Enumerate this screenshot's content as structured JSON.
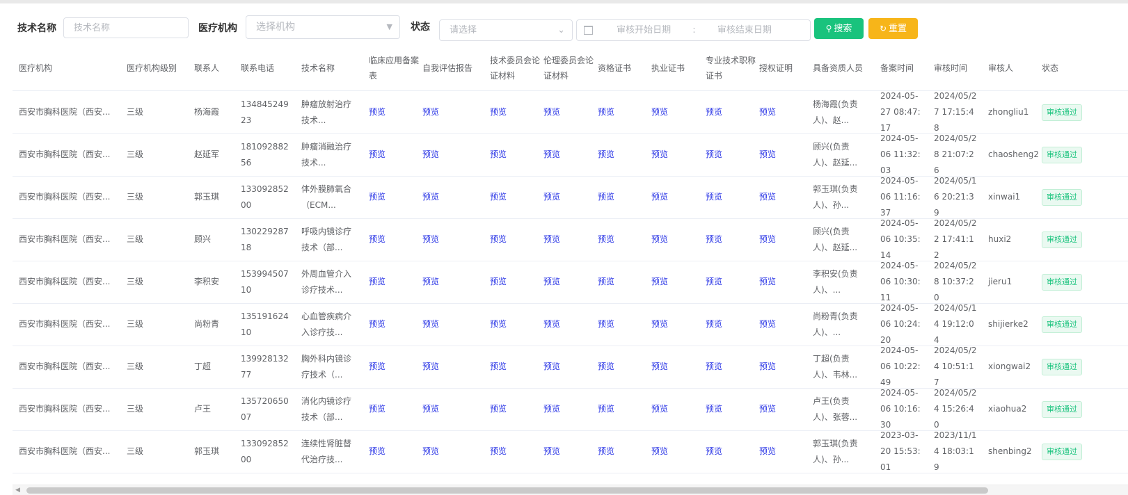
{
  "filters": {
    "tech_label": "技术名称",
    "tech_placeholder": "技术名称",
    "org_label": "医疗机构",
    "org_placeholder": "选择机构",
    "status_label": "状态",
    "status_placeholder": "请选择",
    "date_start_placeholder": "审核开始日期",
    "date_sep": ":",
    "date_end_placeholder": "审核结束日期",
    "search_button": "搜索",
    "reset_button": "重置"
  },
  "columns": [
    "医疗机构",
    "医疗机构级别",
    "联系人",
    "联系电话",
    "技术名称",
    "临床应用备案表",
    "自我评估报告",
    "技术委员会论证材料",
    "伦理委员会论证材料",
    "资格证书",
    "执业证书",
    "专业技术职称证书",
    "授权证明",
    "具备资质人员",
    "备案时间",
    "审核时间",
    "审核人",
    "状态"
  ],
  "preview_label": "预览",
  "rows": [
    {
      "org": "西安市胸科医院（西安...",
      "level": "三级",
      "contact": "杨海霞",
      "phone": "13484524923",
      "tech": "肿瘤放射治疗技术...",
      "staff": "杨海霞(负责人)、赵...",
      "filed": "2024-05-27 08:47:17",
      "audited": "2024/05/27 17:15:48",
      "auditor": "zhongliu1",
      "status": "审核通过"
    },
    {
      "org": "西安市胸科医院（西安...",
      "level": "三级",
      "contact": "赵延军",
      "phone": "18109288256",
      "tech": "肿瘤消融治疗技术...",
      "staff": "顾兴(负责人)、赵延...",
      "filed": "2024-05-06 11:32:03",
      "audited": "2024/05/28 21:07:26",
      "auditor": "chaosheng2",
      "status": "审核通过"
    },
    {
      "org": "西安市胸科医院（西安...",
      "level": "三级",
      "contact": "郭玉琪",
      "phone": "13309285200",
      "tech": "体外膜肺氧合（ECM...",
      "staff": "郭玉琪(负责人)、孙...",
      "filed": "2024-05-06 11:16:37",
      "audited": "2024/05/16 20:21:39",
      "auditor": "xinwai1",
      "status": "审核通过"
    },
    {
      "org": "西安市胸科医院（西安...",
      "level": "三级",
      "contact": "顾兴",
      "phone": "13022928718",
      "tech": "呼吸内镜诊疗技术（部...",
      "staff": "顾兴(负责人)、赵延...",
      "filed": "2024-05-06 10:35:14",
      "audited": "2024/05/22 17:41:12",
      "auditor": "huxi2",
      "status": "审核通过"
    },
    {
      "org": "西安市胸科医院（西安...",
      "level": "三级",
      "contact": "李积安",
      "phone": "15399450710",
      "tech": "外周血管介入诊疗技术...",
      "staff": "李积安(负责人)、...",
      "filed": "2024-05-06 10:30:11",
      "audited": "2024/05/28 10:37:20",
      "auditor": "jieru1",
      "status": "审核通过"
    },
    {
      "org": "西安市胸科医院（西安...",
      "level": "三级",
      "contact": "尚粉青",
      "phone": "13519162410",
      "tech": "心血管疾病介入诊疗技...",
      "staff": "尚粉青(负责人)、...",
      "filed": "2024-05-06 10:24:20",
      "audited": "2024/05/14 19:12:04",
      "auditor": "shijierke2",
      "status": "审核通过"
    },
    {
      "org": "西安市胸科医院（西安...",
      "level": "三级",
      "contact": "丁超",
      "phone": "13992813277",
      "tech": "胸外科内镜诊疗技术（...",
      "staff": "丁超(负责人)、韦林...",
      "filed": "2024-05-06 10:22:49",
      "audited": "2024/05/24 10:51:17",
      "auditor": "xiongwai2",
      "status": "审核通过"
    },
    {
      "org": "西安市胸科医院（西安...",
      "level": "三级",
      "contact": "卢王",
      "phone": "13572065007",
      "tech": "消化内镜诊疗技术（部...",
      "staff": "卢王(负责人)、张蓉...",
      "filed": "2024-05-06 10:16:30",
      "audited": "2024/05/24 15:26:40",
      "auditor": "xiaohua2",
      "status": "审核通过"
    },
    {
      "org": "西安市胸科医院（西安...",
      "level": "三级",
      "contact": "郭玉琪",
      "phone": "13309285200",
      "tech": "连续性肾脏替代治疗技...",
      "staff": "郭玉琪(负责人)、孙...",
      "filed": "2023-03-20 15:53:01",
      "audited": "2023/11/14 18:03:19",
      "auditor": "shenbing2",
      "status": "审核通过"
    }
  ],
  "icons": {
    "calendar": "calendar-icon",
    "search": "search-icon",
    "reset": "refresh-icon",
    "chevron": "chevron-down-icon"
  },
  "colors": {
    "primary_link": "#2a35e6",
    "success": "#19c37d",
    "warning": "#f7b519"
  }
}
